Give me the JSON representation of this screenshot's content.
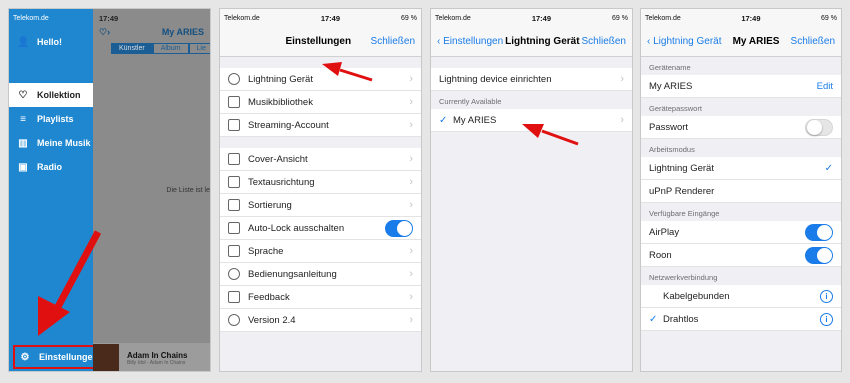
{
  "status": {
    "carrier": "Telekom.de",
    "time": "17:49",
    "battery": "69 %"
  },
  "screen1": {
    "hello": "Hello!",
    "menu": [
      "Kollektion",
      "Playlists",
      "Meine Musik",
      "Radio"
    ],
    "settings": "Einstellungen",
    "header_title": "My ARIES",
    "tabs": [
      "Künstler",
      "Album",
      "Lie"
    ],
    "empty": "Die Liste ist le",
    "now_playing": {
      "title": "Adam In Chains",
      "artist": "Billy Idol · Adam In Chains"
    }
  },
  "screen2": {
    "title": "Einstellungen",
    "close": "Schließen",
    "group1": [
      "Lightning Gerät",
      "Musikbibliothek",
      "Streaming-Account"
    ],
    "group2": [
      "Cover-Ansicht",
      "Textausrichtung",
      "Sortierung",
      "Auto-Lock ausschalten",
      "Sprache",
      "Bedienungsanleitung",
      "Feedback",
      "Version 2.4"
    ],
    "autolock_on": true
  },
  "screen3": {
    "back": "Einstellungen",
    "title": "Lightning Gerät",
    "close": "Schließen",
    "setup": "Lightning device einrichten",
    "section": "Currently Available",
    "device": "My ARIES"
  },
  "screen4": {
    "back": "Lightning Gerät",
    "title": "My ARIES",
    "close": "Schließen",
    "s_name": "Gerätename",
    "name": "My ARIES",
    "edit": "Edit",
    "s_pass": "Gerätepasswort",
    "pass": "Passwort",
    "s_mode": "Arbeitsmodus",
    "mode1": "Lightning Gerät",
    "mode2": "uPnP Renderer",
    "s_inputs": "Verfügbare Eingänge",
    "in1": "AirPlay",
    "in2": "Roon",
    "s_net": "Netzwerkverbindung",
    "net1": "Kabelgebunden",
    "net2": "Drahtlos"
  },
  "colors": {
    "accent": "#1a7ce8",
    "arrow": "#e01010",
    "sidebar": "#1f87d0"
  }
}
